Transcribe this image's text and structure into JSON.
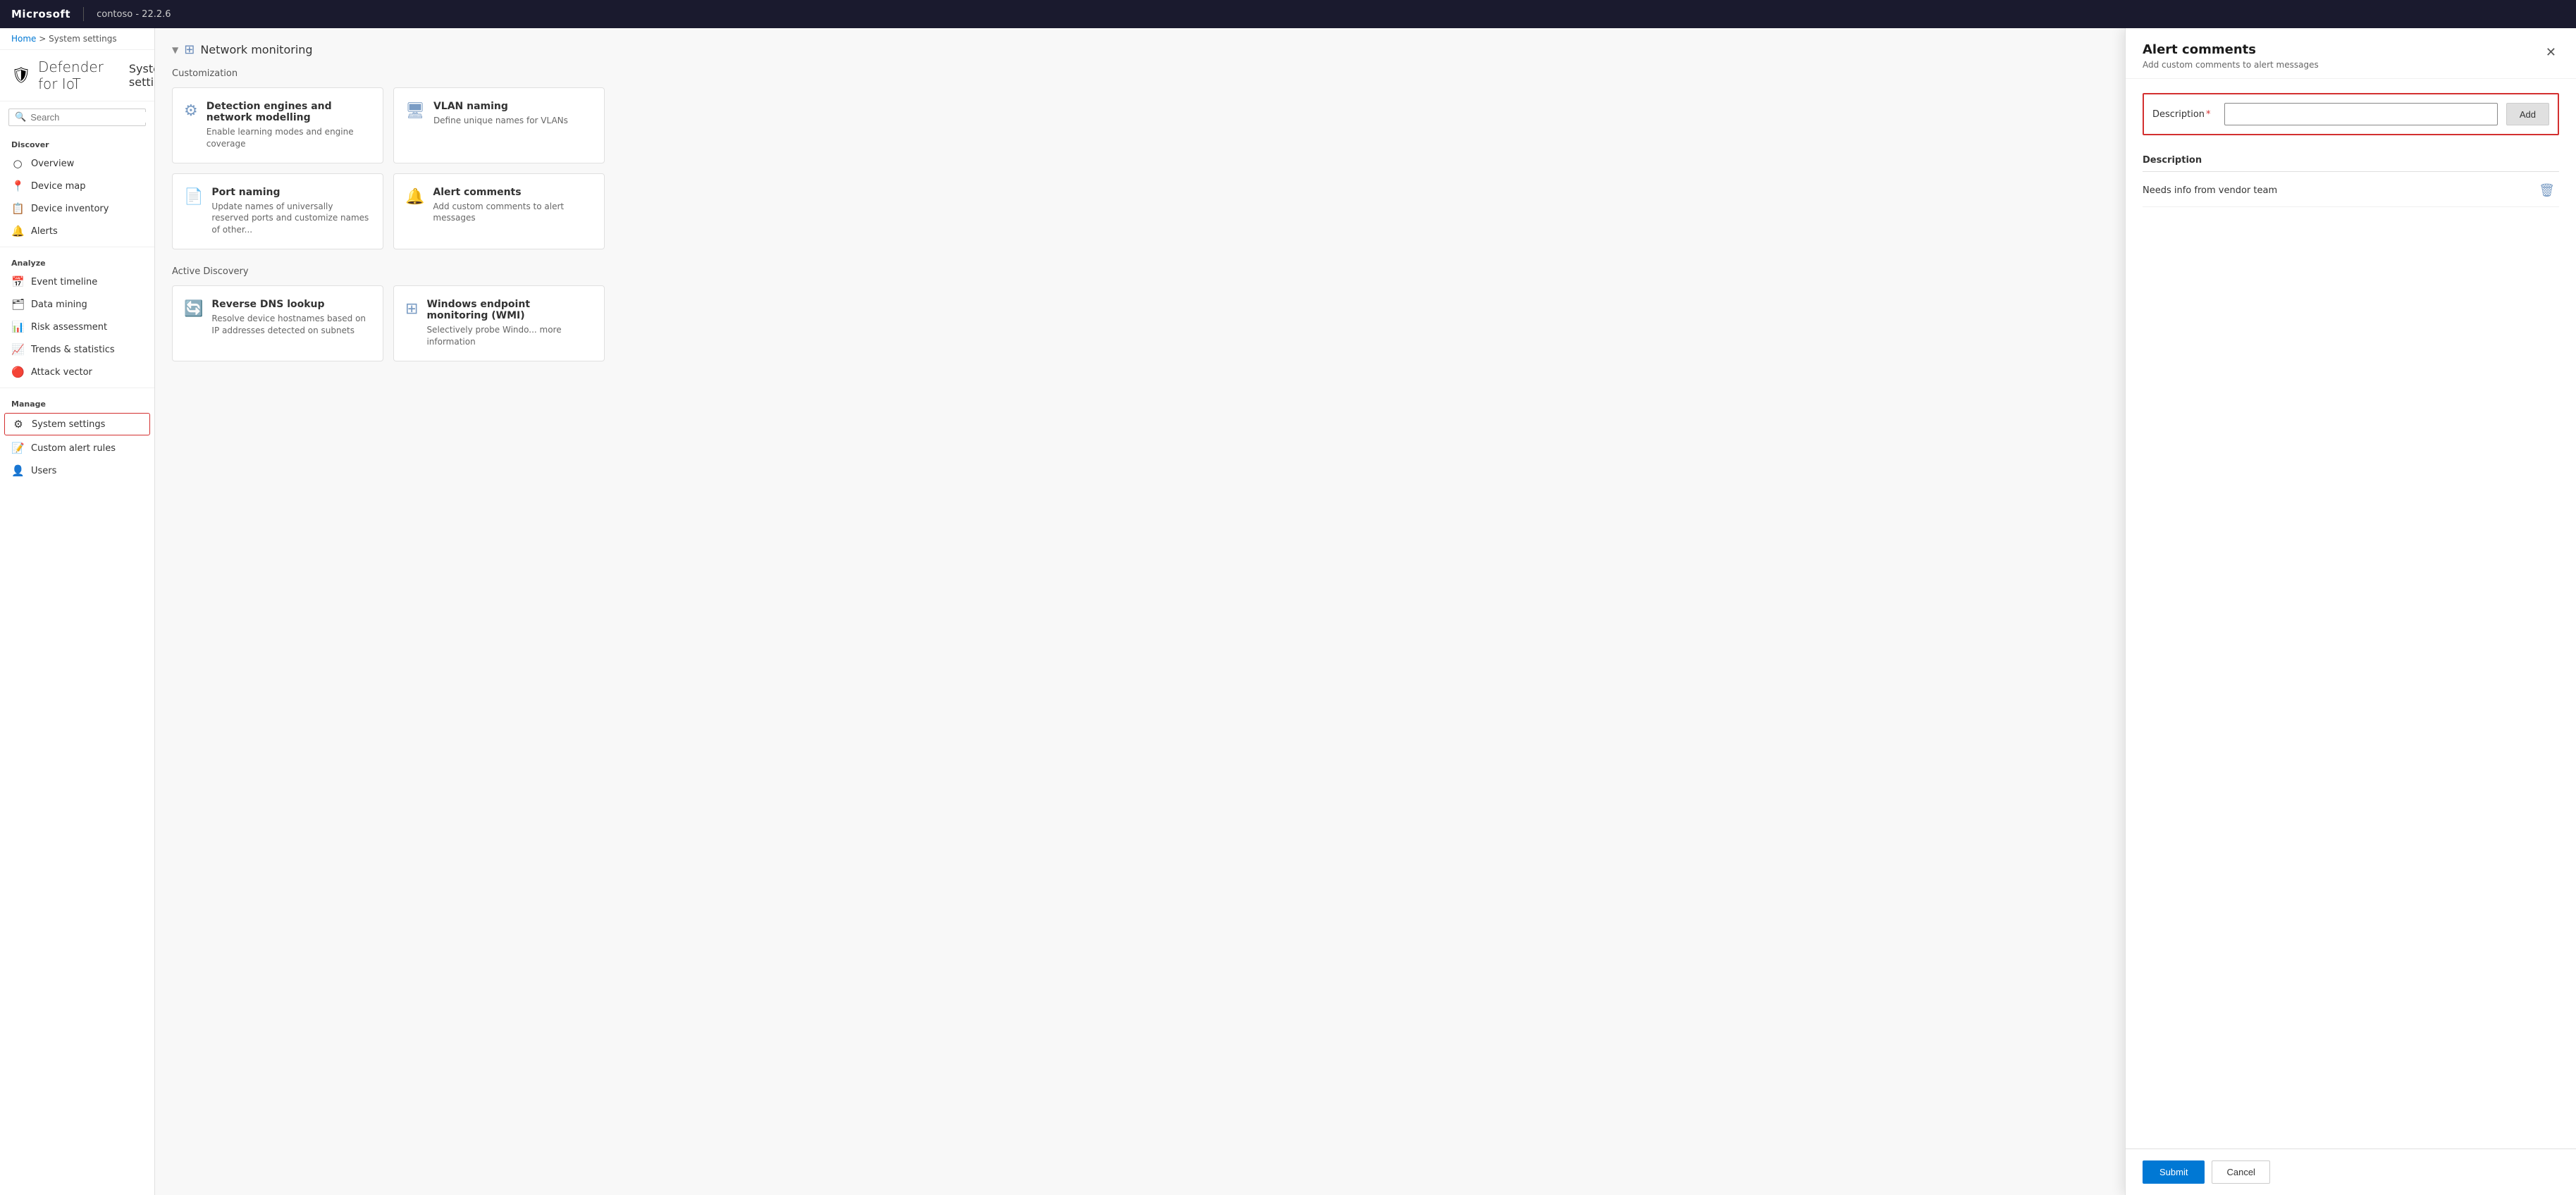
{
  "topbar": {
    "brand": "Microsoft",
    "app_info": "contoso - 22.2.6"
  },
  "breadcrumb": {
    "home": "Home",
    "separator": ">",
    "current": "System settings"
  },
  "page_title": {
    "icon": "🛡",
    "app_name": "Defender for IoT",
    "section": "System settings"
  },
  "search": {
    "placeholder": "Search"
  },
  "sidebar": {
    "discover_label": "Discover",
    "analyze_label": "Analyze",
    "manage_label": "Manage",
    "items": [
      {
        "id": "overview",
        "label": "Overview",
        "icon": "○"
      },
      {
        "id": "device-map",
        "label": "Device map",
        "icon": "📍"
      },
      {
        "id": "device-inventory",
        "label": "Device inventory",
        "icon": "📋"
      },
      {
        "id": "alerts",
        "label": "Alerts",
        "icon": "🔔"
      },
      {
        "id": "event-timeline",
        "label": "Event timeline",
        "icon": "📅"
      },
      {
        "id": "data-mining",
        "label": "Data mining",
        "icon": "🗂"
      },
      {
        "id": "risk-assessment",
        "label": "Risk assessment",
        "icon": "📊"
      },
      {
        "id": "trends-statistics",
        "label": "Trends & statistics",
        "icon": "📈"
      },
      {
        "id": "attack-vector",
        "label": "Attack vector",
        "icon": "🔴"
      },
      {
        "id": "system-settings",
        "label": "System settings",
        "icon": "⚙"
      },
      {
        "id": "custom-alert-rules",
        "label": "Custom alert rules",
        "icon": "📝"
      },
      {
        "id": "users",
        "label": "Users",
        "icon": "👤"
      }
    ]
  },
  "content": {
    "network_monitoring": {
      "section_title": "Network monitoring",
      "section_icon": "⊞",
      "customization_label": "Customization",
      "cards": [
        {
          "id": "detection-engines",
          "icon": "⚙",
          "title": "Detection engines and network modelling",
          "desc": "Enable learning modes and engine coverage"
        },
        {
          "id": "vlan-naming",
          "icon": "🖥",
          "title": "VLAN naming",
          "desc": "Define unique names for VLANs"
        },
        {
          "id": "port-naming",
          "icon": "📄",
          "title": "Port naming",
          "desc": "Update names of universally reserved ports and customize names of other..."
        },
        {
          "id": "alert-comments",
          "icon": "🔔",
          "title": "Alert comments",
          "desc": "Add custom comments to alert messages"
        }
      ]
    },
    "active_discovery": {
      "label": "Active Discovery",
      "cards": [
        {
          "id": "reverse-dns",
          "icon": "🔄",
          "title": "Reverse DNS lookup",
          "desc": "Resolve device hostnames based on IP addresses detected on subnets"
        },
        {
          "id": "windows-endpoint",
          "icon": "⊞",
          "title": "Windows endpoint monitoring (WMI)",
          "desc": "Selectively probe Windo... more information"
        }
      ]
    }
  },
  "panel": {
    "title": "Alert comments",
    "subtitle": "Add custom comments to alert messages",
    "form": {
      "description_label": "Description",
      "description_required": "*",
      "input_placeholder": "",
      "add_button": "Add"
    },
    "table": {
      "header": "Description",
      "rows": [
        {
          "text": "Needs info from vendor team"
        }
      ]
    },
    "footer": {
      "submit_label": "Submit",
      "cancel_label": "Cancel"
    }
  }
}
